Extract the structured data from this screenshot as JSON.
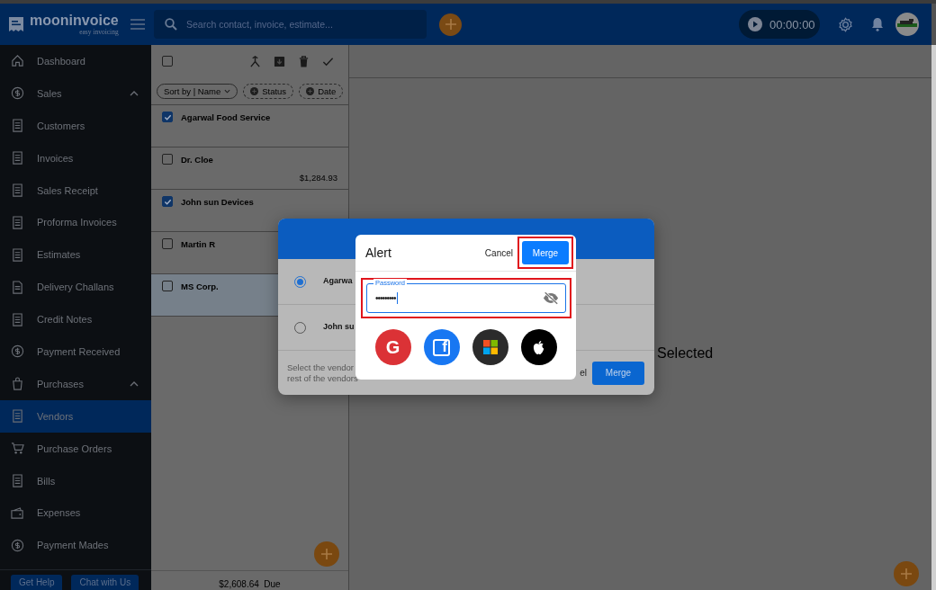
{
  "header": {
    "logo": {
      "name": "mooninvoice",
      "tagline": "easy invoicing"
    },
    "search": {
      "placeholder": "Search contact, invoice, estimate..."
    },
    "timer": "00:00:00"
  },
  "sidebar": {
    "items": [
      {
        "label": "Dashboard",
        "kind": "link",
        "selected": false
      },
      {
        "label": "Sales",
        "kind": "section",
        "expanded": true,
        "children": [
          {
            "label": "Customers",
            "kind": "link",
            "selected": false
          },
          {
            "label": "Invoices",
            "kind": "link",
            "selected": false
          },
          {
            "label": "Sales Receipt",
            "kind": "link",
            "selected": false
          },
          {
            "label": "Proforma Invoices",
            "kind": "link",
            "selected": false
          },
          {
            "label": "Estimates",
            "kind": "link",
            "selected": false
          },
          {
            "label": "Delivery Challans",
            "kind": "link",
            "selected": false
          },
          {
            "label": "Credit Notes",
            "kind": "link",
            "selected": false
          },
          {
            "label": "Payment Received",
            "kind": "link",
            "selected": false
          }
        ]
      },
      {
        "label": "Purchases",
        "kind": "section",
        "expanded": true,
        "children": [
          {
            "label": "Vendors",
            "kind": "link",
            "selected": true
          },
          {
            "label": "Purchase Orders",
            "kind": "link",
            "selected": false
          },
          {
            "label": "Bills",
            "kind": "link",
            "selected": false
          },
          {
            "label": "Expenses",
            "kind": "link",
            "selected": false
          },
          {
            "label": "Payment Mades",
            "kind": "link",
            "selected": false
          }
        ]
      }
    ],
    "buttons": [
      "Get Help",
      "Chat with Us"
    ]
  },
  "list": {
    "select_all": {
      "checked": false
    },
    "chips": [
      {
        "label": "Sort by | Name",
        "kind": "sort"
      },
      {
        "label": "Status",
        "kind": "filter"
      },
      {
        "label": "Date",
        "kind": "filter"
      }
    ],
    "rows": [
      {
        "name": "Agarwal Food Service",
        "checked": true,
        "selected": false
      },
      {
        "name": "Dr. Cloe",
        "amount": "$1,284.93",
        "checked": false,
        "selected": false
      },
      {
        "name": "John sun Devices",
        "checked": true,
        "selected": false
      },
      {
        "name": "Martin R",
        "checked": false,
        "selected": false
      },
      {
        "name": "MS Corp.",
        "checked": false,
        "selected": true
      }
    ],
    "footer": {
      "amount": "$2,608.64",
      "label": "Due"
    }
  },
  "detail": {
    "message": "Selected"
  },
  "merge_dialog": {
    "options": [
      {
        "label": "Agarwa",
        "selected": true
      },
      {
        "label": "John su",
        "selected": false
      }
    ],
    "hint": [
      "Select the vendor",
      "rest of the vendors"
    ],
    "cancel": "el",
    "button": "Merge"
  },
  "alert": {
    "title": "Alert",
    "cancel": "Cancel",
    "confirm": {
      "label": "Merge",
      "highlighted": true
    },
    "password": {
      "label": "Password",
      "value": "•••••••••",
      "highlighted": true
    },
    "social": [
      {
        "kind": "google",
        "glyph": "G"
      },
      {
        "kind": "facebook",
        "glyph": "f"
      },
      {
        "kind": "microsoft"
      },
      {
        "kind": "apple"
      }
    ]
  }
}
